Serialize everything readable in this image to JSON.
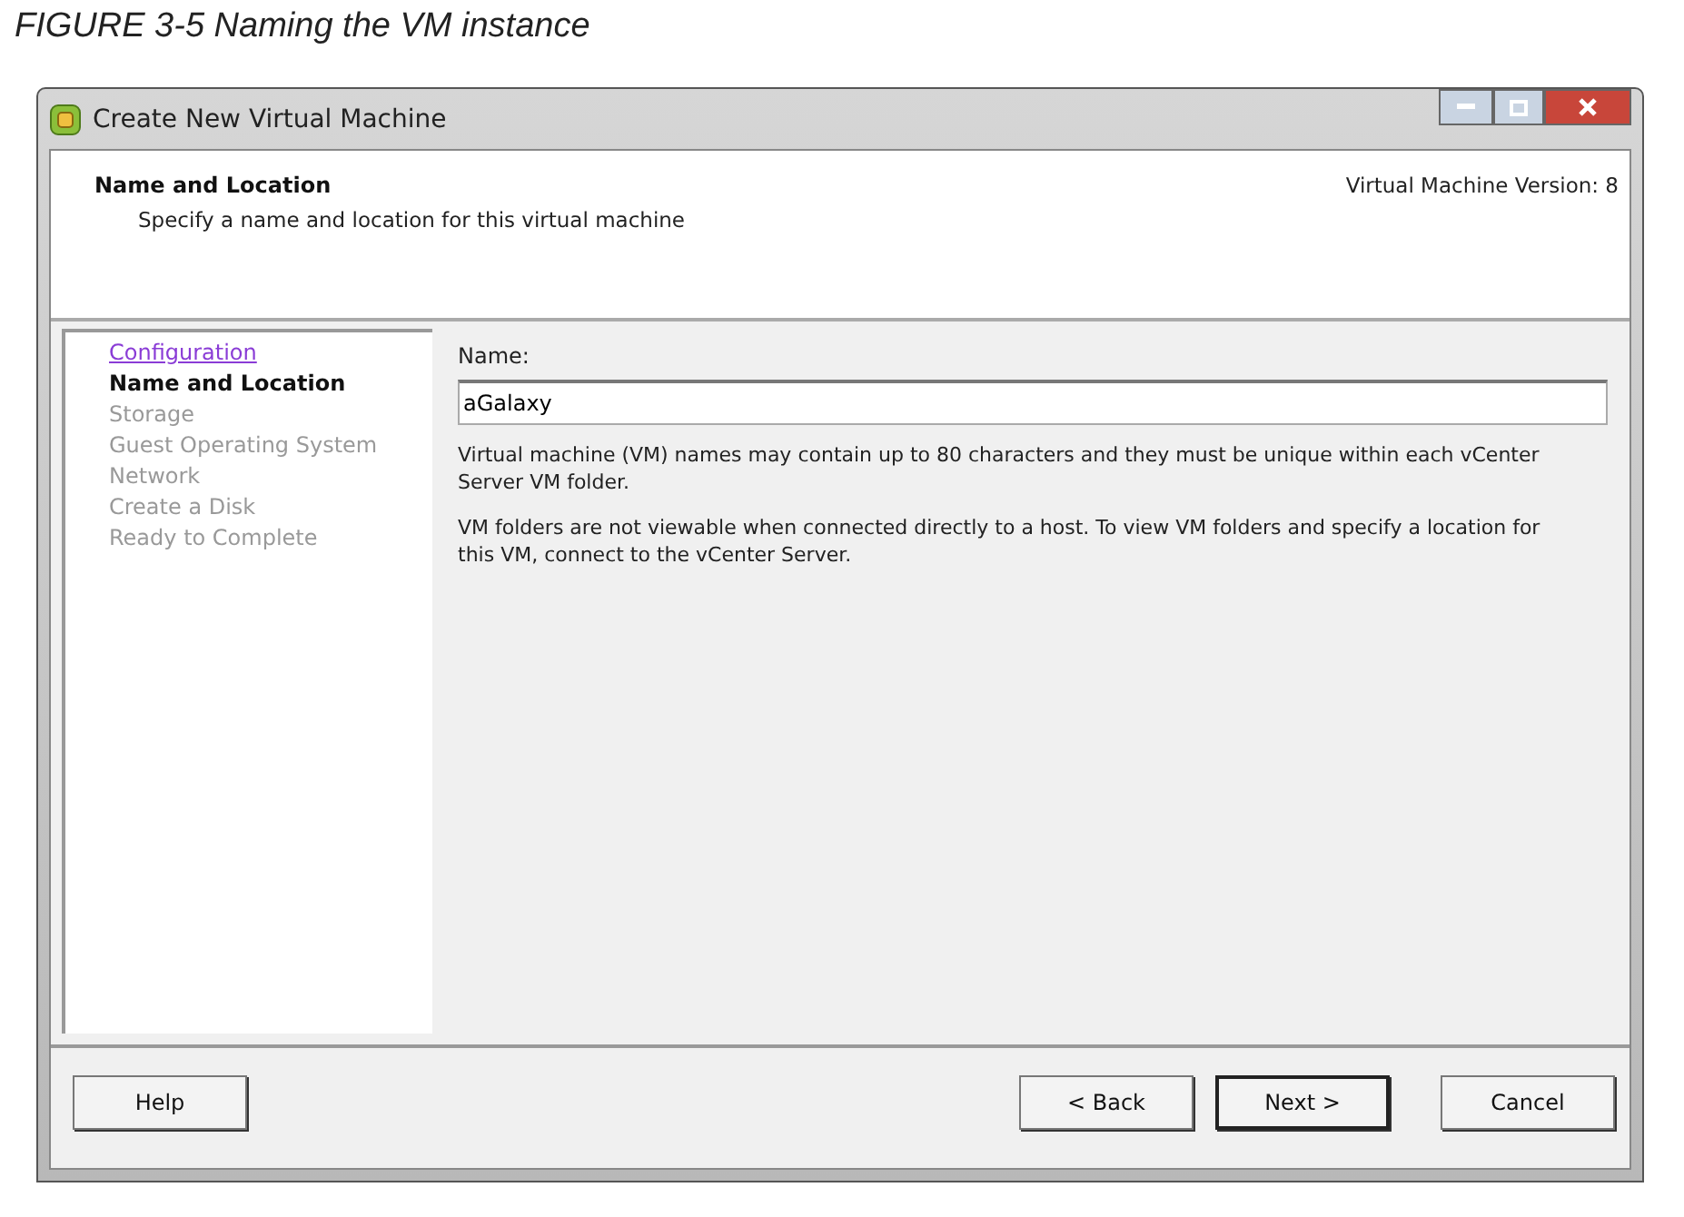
{
  "caption": "FIGURE 3-5  Naming the VM instance",
  "window": {
    "title": "Create New Virtual Machine"
  },
  "header": {
    "title": "Name and Location",
    "subtitle": "Specify a name and location for this virtual machine",
    "version": "Virtual Machine Version: 8"
  },
  "steps": [
    {
      "label": "Configuration",
      "visited": true,
      "selected": false
    },
    {
      "label": "Name and Location",
      "visited": false,
      "selected": true
    },
    {
      "label": "Storage",
      "visited": false,
      "selected": false
    },
    {
      "label": "Guest Operating System",
      "visited": false,
      "selected": false
    },
    {
      "label": "Network",
      "visited": false,
      "selected": false
    },
    {
      "label": "Create a Disk",
      "visited": false,
      "selected": false
    },
    {
      "label": "Ready to Complete",
      "visited": false,
      "selected": false
    }
  ],
  "form": {
    "label": "Name:",
    "value": "aGalaxy",
    "notes": [
      "Virtual machine (VM) names may contain up to 80 characters and they must be unique within each vCenter Server VM folder.",
      "VM folders are not viewable when connected directly to a host. To view VM folders and specify a location for this VM, connect to the vCenter Server."
    ]
  },
  "help_button": "Help",
  "buttons": [
    {
      "label": "< Back",
      "default": false
    },
    {
      "label": "Next >",
      "default": true
    },
    {
      "label": "Cancel",
      "default": false
    }
  ]
}
